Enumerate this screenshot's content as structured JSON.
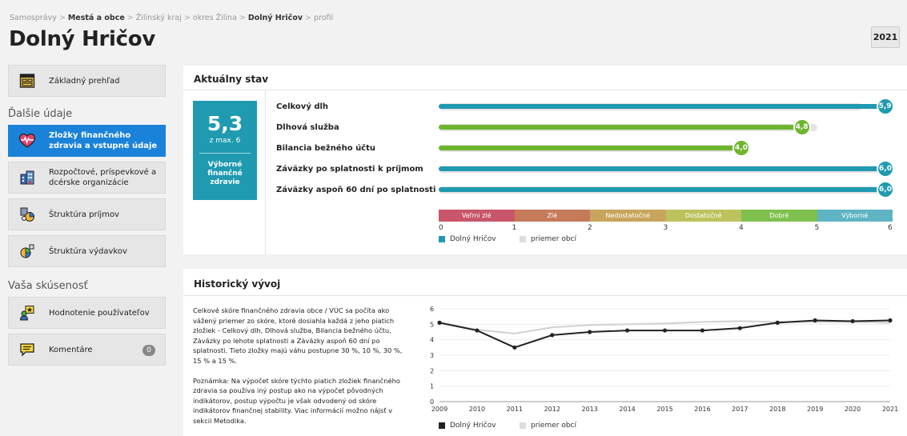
{
  "breadcrumb": {
    "items": [
      "Samosprávy",
      "Mestá a obce",
      "Žilinský kraj",
      "okres Žilina",
      "Dolný Hričov",
      "profil"
    ]
  },
  "page": {
    "title": "Dolný Hričov",
    "year": "2021"
  },
  "sidebar": {
    "overview_label": "Základný prehľad",
    "section_more": "Ďalšie údaje",
    "items": [
      {
        "label": "Zložky finančného zdravia a vstupné údaje",
        "icon": "heart-pulse-icon",
        "active": true
      },
      {
        "label": "Rozpočtové, príspevkové a dcérske organizácie",
        "icon": "buildings-icon",
        "active": false
      },
      {
        "label": "Štruktúra príjmov",
        "icon": "income-structure-icon",
        "active": false
      },
      {
        "label": "Štruktúra výdavkov",
        "icon": "expense-structure-icon",
        "active": false
      }
    ],
    "section_experience": "Vaša skúsenosť",
    "rating_label": "Hodnotenie používateľov",
    "comments_label": "Komentáre",
    "comments_count": "0"
  },
  "current": {
    "title": "Aktuálny stav",
    "score": "5,3",
    "score_max": "z max. 6",
    "score_label": "Výborné finančné zdravie",
    "rows": [
      {
        "label": "Celkový dlh",
        "value": 5.9,
        "display": "5,9",
        "avg": 5.6,
        "color": "#1f9ab0"
      },
      {
        "label": "Dlhová služba",
        "value": 4.8,
        "display": "4,8",
        "avg": 5.0,
        "color": "#6cb52d"
      },
      {
        "label": "Bilancia bežného účtu",
        "value": 4.0,
        "display": "4,0",
        "avg": 3.9,
        "color": "#6cb52d"
      },
      {
        "label": "Záväzky po splatnosti k príjmom",
        "value": 6.0,
        "display": "6,0",
        "avg": 6.0,
        "color": "#1f9ab0"
      },
      {
        "label": "Záväzky aspoň 60 dní po splatnosti",
        "value": 6.0,
        "display": "6,0",
        "avg": 6.0,
        "color": "#1f9ab0"
      }
    ],
    "scale": [
      {
        "label": "Veľmi zlé",
        "color": "#c9556a"
      },
      {
        "label": "Zlé",
        "color": "#c57a5a"
      },
      {
        "label": "Nedostatočné",
        "color": "#c8a55c"
      },
      {
        "label": "Dostatočné",
        "color": "#bcc25c"
      },
      {
        "label": "Dobré",
        "color": "#7fc04e"
      },
      {
        "label": "Výborné",
        "color": "#5fb4c4"
      }
    ],
    "ticks": [
      "0",
      "1",
      "2",
      "3",
      "4",
      "5",
      "6"
    ],
    "legend_town": "Dolný Hričov",
    "legend_avg": "priemer obcí",
    "town_color": "#1f9ab0",
    "avg_color": "#dddddd"
  },
  "history": {
    "title": "Historický vývoj",
    "para1": "Celkové skóre finančného zdravia obce / VÚC sa počíta ako vážený priemer zo skóre, ktoré dosiahla každá z jeho piatich zložiek - Celkový dlh, Dlhová služba, Bilancia bežného účtu, Záväzky po lehote splatnosti a Záväzky aspoň 60 dní po splatnosti. Tieto zložky majú váhu postupne 30 %, 10 %, 30 %, 15 % a 15 %.",
    "para2": "Poznámka: Na výpočet skóre týchto piatich zložiek finančného zdravia sa používa iný postup ako na výpočet pôvodných indikátorov, postup výpočtu je však odvodený od skóre indikátorov finančnej stability. Viac informácií možno nájsť v sekcii Metodika.",
    "legend_town": "Dolný Hričov",
    "legend_avg": "priemer obcí"
  },
  "chart_data": {
    "type": "line",
    "x": [
      2009,
      2010,
      2011,
      2012,
      2013,
      2014,
      2015,
      2016,
      2017,
      2018,
      2019,
      2020,
      2021
    ],
    "ylim": [
      0,
      6
    ],
    "yticks": [
      "0",
      "1",
      "2",
      "3",
      "4",
      "5",
      "6"
    ],
    "grid": true,
    "legend": "bottom",
    "series": [
      {
        "name": "Dolný Hričov",
        "color": "#222222",
        "values": [
          5.1,
          4.6,
          3.5,
          4.3,
          4.5,
          4.6,
          4.6,
          4.6,
          4.75,
          5.1,
          5.25,
          5.2,
          5.25
        ]
      },
      {
        "name": "priemer obcí",
        "color": "#d3d3d3",
        "values": [
          5.1,
          4.65,
          4.4,
          4.8,
          4.95,
          5.0,
          5.05,
          5.15,
          5.2,
          5.15,
          5.15,
          5.15,
          5.1
        ]
      }
    ]
  }
}
